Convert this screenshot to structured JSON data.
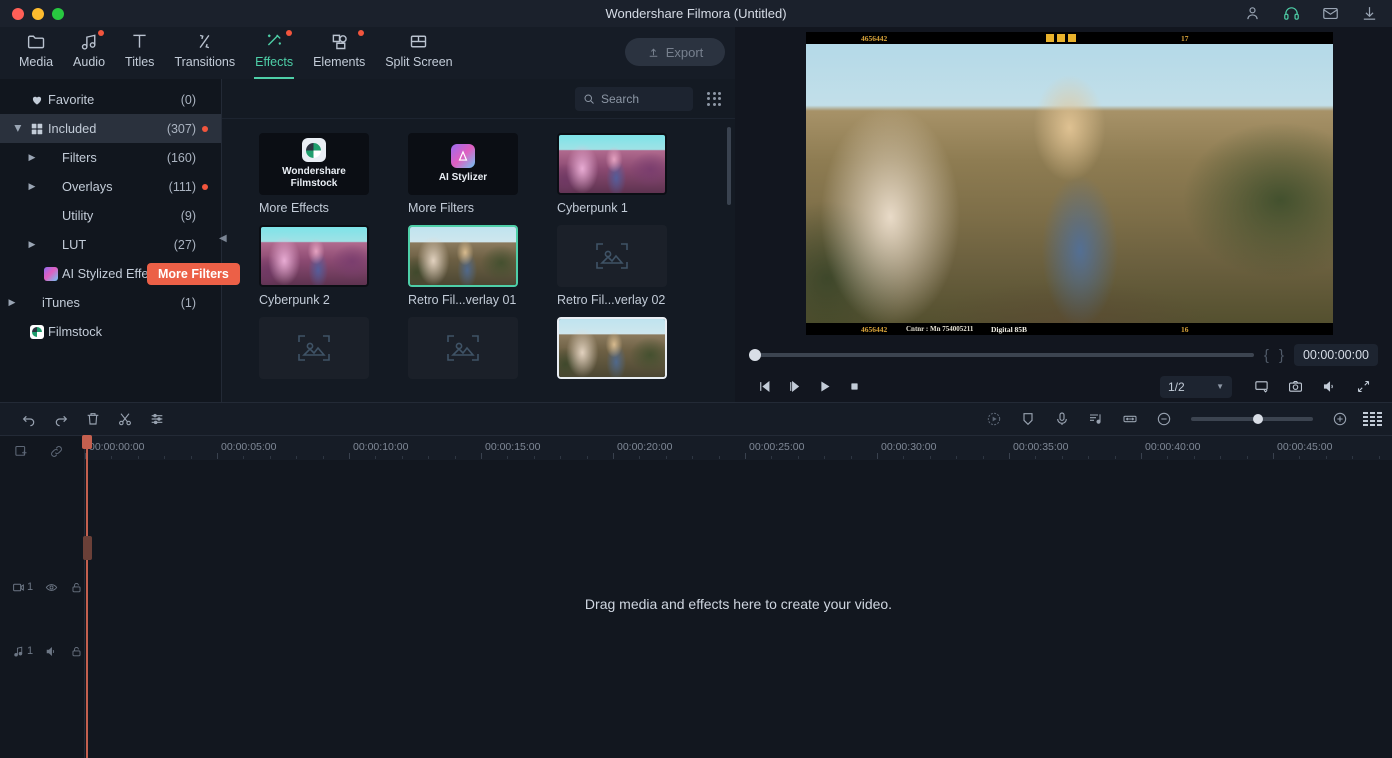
{
  "titlebar": {
    "title": "Wondershare Filmora (Untitled)",
    "window_controls": [
      "close",
      "minimize",
      "zoom"
    ],
    "icons": [
      {
        "name": "account-icon",
        "glyph": "user"
      },
      {
        "name": "support-headset-icon",
        "glyph": "headset",
        "color": "#4ecfa8"
      },
      {
        "name": "mail-icon",
        "glyph": "envelope"
      },
      {
        "name": "download-icon",
        "glyph": "download"
      }
    ]
  },
  "toolbar": {
    "tabs": [
      {
        "label": "Media",
        "icon": "folder-icon",
        "active": false,
        "badge": false
      },
      {
        "label": "Audio",
        "icon": "music-note-icon",
        "active": false,
        "badge": true
      },
      {
        "label": "Titles",
        "icon": "text-t-icon",
        "active": false,
        "badge": false
      },
      {
        "label": "Transitions",
        "icon": "transition-arrows-icon",
        "active": false,
        "badge": false
      },
      {
        "label": "Effects",
        "icon": "magic-wand-icon",
        "active": true,
        "badge": true
      },
      {
        "label": "Elements",
        "icon": "elements-shapes-icon",
        "active": false,
        "badge": true
      },
      {
        "label": "Split Screen",
        "icon": "split-screen-icon",
        "active": false,
        "badge": false
      }
    ],
    "export_label": "Export",
    "export_enabled": false,
    "accent_color": "#4ecfa8"
  },
  "sidebar": {
    "items": [
      {
        "label": "Favorite",
        "count": "(0)",
        "icon": "heart-icon",
        "indent": 1,
        "caret": "none",
        "selected": false,
        "dot": false
      },
      {
        "label": "Included",
        "count": "(307)",
        "icon": "grid-squares-icon",
        "indent": 1,
        "caret": "down",
        "selected": true,
        "dot": true
      },
      {
        "label": "Filters",
        "count": "(160)",
        "icon": "none",
        "indent": 2,
        "caret": "right",
        "selected": false,
        "dot": false
      },
      {
        "label": "Overlays",
        "count": "(111)",
        "icon": "none",
        "indent": 2,
        "caret": "right",
        "selected": false,
        "dot": true
      },
      {
        "label": "Utility",
        "count": "(9)",
        "icon": "none",
        "indent": 2,
        "caret": "none",
        "selected": false,
        "dot": false
      },
      {
        "label": "LUT",
        "count": "(27)",
        "icon": "none",
        "indent": 2,
        "caret": "right",
        "selected": false,
        "dot": false
      },
      {
        "label": "AI Stylized Effects",
        "count": "",
        "icon": "ai-gradient-icon",
        "indent": 2,
        "caret": "none",
        "selected": false,
        "dot": false
      },
      {
        "label": "iTunes",
        "count": "(1)",
        "icon": "none",
        "indent": 1,
        "caret": "right",
        "selected": false,
        "dot": false
      },
      {
        "label": "Filmstock",
        "count": "",
        "icon": "filmstock-icon",
        "indent": 1,
        "caret": "none",
        "selected": false,
        "dot": false
      }
    ],
    "tooltip": {
      "label": "More Filters",
      "color": "#ec6047"
    },
    "collapse_icon": "collapse-panel-icon"
  },
  "effects": {
    "search": {
      "placeholder": "Search",
      "value": "",
      "icon": "search-icon"
    },
    "view_toggle_icon": "grid-view-icon",
    "tiles": [
      {
        "label": "More Effects",
        "kind": "brand-wondershare",
        "brand_text": "Wondershare\nFilmstock",
        "state": "normal"
      },
      {
        "label": "More Filters",
        "kind": "brand-ai",
        "brand_text": "AI Stylizer",
        "state": "normal"
      },
      {
        "label": "Cyberpunk 1",
        "kind": "thumb-cyber",
        "state": "normal"
      },
      {
        "label": "Cyberpunk 2",
        "kind": "thumb-cyber",
        "state": "normal"
      },
      {
        "label": "Retro Fil...verlay 01",
        "kind": "thumb-vine",
        "state": "selected"
      },
      {
        "label": "Retro Fil...verlay 02",
        "kind": "placeholder",
        "state": "normal"
      },
      {
        "label": "",
        "kind": "placeholder",
        "state": "normal"
      },
      {
        "label": "",
        "kind": "placeholder",
        "state": "normal"
      },
      {
        "label": "",
        "kind": "thumb-vine",
        "state": "hovered"
      }
    ]
  },
  "preview": {
    "film_strip": {
      "top_left_code": "4656442",
      "top_right_code": "17",
      "bottom_left_code": "4656442",
      "bottom_center_code": "Cntnr : Mn 754005211",
      "bottom_label": "Digital 85B",
      "bottom_right_code": "16"
    },
    "timecode": "00:00:00:00",
    "brace_left": "{",
    "brace_right": "}",
    "quality": "1/2",
    "controls": [
      {
        "name": "prev-frame-button",
        "icon": "step-backward-icon"
      },
      {
        "name": "next-frame-button",
        "icon": "step-forward-icon"
      },
      {
        "name": "play-button",
        "icon": "play-icon"
      },
      {
        "name": "stop-button",
        "icon": "stop-icon"
      }
    ],
    "right_controls": [
      {
        "name": "display-settings-button",
        "icon": "monitor-icon"
      },
      {
        "name": "snapshot-button",
        "icon": "camera-icon"
      },
      {
        "name": "volume-button",
        "icon": "speaker-icon"
      },
      {
        "name": "fullscreen-button",
        "icon": "expand-arrows-icon"
      }
    ]
  },
  "timeline": {
    "left_tools": [
      {
        "name": "undo-button",
        "icon": "undo-arrow-icon"
      },
      {
        "name": "redo-button",
        "icon": "redo-arrow-icon"
      },
      {
        "name": "delete-button",
        "icon": "trash-icon"
      },
      {
        "name": "split-button",
        "icon": "scissors-icon"
      },
      {
        "name": "adjust-button",
        "icon": "sliders-icon"
      }
    ],
    "right_tools": [
      {
        "name": "render-preview-button",
        "icon": "render-preview-icon"
      },
      {
        "name": "marker-button",
        "icon": "marker-shield-icon"
      },
      {
        "name": "voiceover-button",
        "icon": "microphone-icon"
      },
      {
        "name": "audio-detach-button",
        "icon": "audio-note-icon"
      },
      {
        "name": "fit-timeline-button",
        "icon": "fit-width-icon"
      },
      {
        "name": "zoom-out-button",
        "icon": "minus-circle-icon"
      },
      {
        "name": "zoom-in-button",
        "icon": "plus-circle-icon"
      },
      {
        "name": "level-meter-button",
        "icon": "audio-levels-icon"
      }
    ],
    "zoom_value": 50,
    "ruler_labels": [
      "00:00:00:00",
      "00:00:05:00",
      "00:00:10:00",
      "00:00:15:00",
      "00:00:20:00",
      "00:00:25:00",
      "00:00:30:00",
      "00:00:35:00",
      "00:00:40:00",
      "00:00:45:00"
    ],
    "head_tools": [
      {
        "name": "add-track-button",
        "icon": "add-track-icon"
      },
      {
        "name": "link-button",
        "icon": "link-icon"
      }
    ],
    "tracks": [
      {
        "name": "video-track",
        "label": "1",
        "icon": "video-track-icon",
        "toggles": [
          "eye-icon",
          "lock-icon"
        ]
      },
      {
        "name": "audio-track",
        "label": "1",
        "icon": "audio-track-icon",
        "toggles": [
          "speaker-icon",
          "lock-icon"
        ]
      }
    ],
    "drag_hint": "Drag media and effects here to create your video.",
    "playhead_color": "#c4604f"
  }
}
